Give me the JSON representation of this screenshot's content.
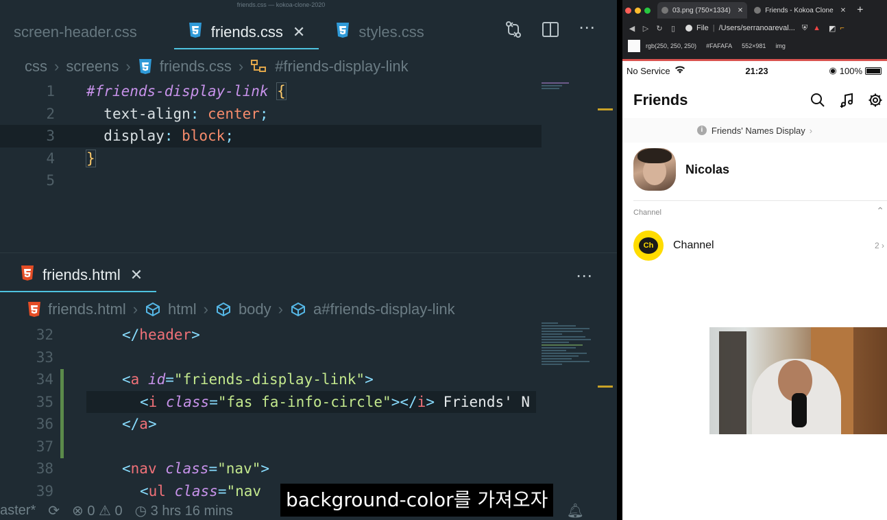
{
  "editor": {
    "window_title": "friends.css — kokoa-clone-2020",
    "top_tabs": [
      {
        "label": "screen-header.css",
        "active": false
      },
      {
        "label": "friends.css",
        "active": true
      },
      {
        "label": "styles.css",
        "active": false
      }
    ],
    "css_breadcrumb": [
      "css",
      "screens",
      "friends.css",
      "#friends-display-link"
    ],
    "css_lines": {
      "n1": "1",
      "n2": "2",
      "n3": "3",
      "n4": "4",
      "n5": "5",
      "selector": "#friends-display-link",
      "open_brace": "{",
      "close_brace": "}",
      "prop1": "text-align",
      "val1": "center",
      "prop2": "display",
      "val2": "block"
    },
    "bottom_tab": "friends.html",
    "html_breadcrumb": [
      "friends.html",
      "html",
      "body",
      "a#friends-display-link"
    ],
    "html_lines": {
      "n32": "32",
      "n33": "33",
      "n34": "34",
      "n35": "35",
      "n36": "36",
      "n37": "37",
      "n38": "38",
      "n39": "39",
      "tag_header": "header",
      "tag_a": "a",
      "attr_id": "id",
      "val_id": "\"friends-display-link\"",
      "tag_i": "i",
      "attr_class": "class",
      "val_class_i": "\"fas fa-info-circle\"",
      "text_i": " Friends' N",
      "tag_nav": "nav",
      "val_class_nav": "\"nav\"",
      "tag_ul": "ul",
      "val_class_ul": "\"nav"
    },
    "status": {
      "branch": "aster*",
      "errors": "0",
      "warnings": "0",
      "time": "3 hrs 16 mins"
    },
    "subtitle": "background-color를 가져오자"
  },
  "browser": {
    "tabs": [
      {
        "label": "03.png (750×1334)",
        "active": true
      },
      {
        "label": "Friends - Kokoa Clone",
        "active": false
      }
    ],
    "url_scheme": "File",
    "url": "/Users/serranoareval...",
    "inspector": {
      "rgb": "rgb(250, 250, 250)",
      "hex": "#FAFAFA",
      "size": "552×981",
      "tag": "img"
    },
    "phone": {
      "carrier": "No Service",
      "time": "21:23",
      "battery": "100%",
      "title": "Friends",
      "display_link": "Friends' Names Display",
      "profile_name": "Nicolas",
      "channel_section": "Channel",
      "channel_logo": "Ch",
      "channel_name": "Channel",
      "channel_count": "2"
    }
  },
  "colors": {
    "editor_bg": "#1f2b33",
    "selector": "#c792ea",
    "value": "#f78c6c",
    "string": "#c3e88d",
    "tag": "#f07178",
    "accent": "#4ec3e0",
    "kakao_yellow": "#ffdc00"
  }
}
